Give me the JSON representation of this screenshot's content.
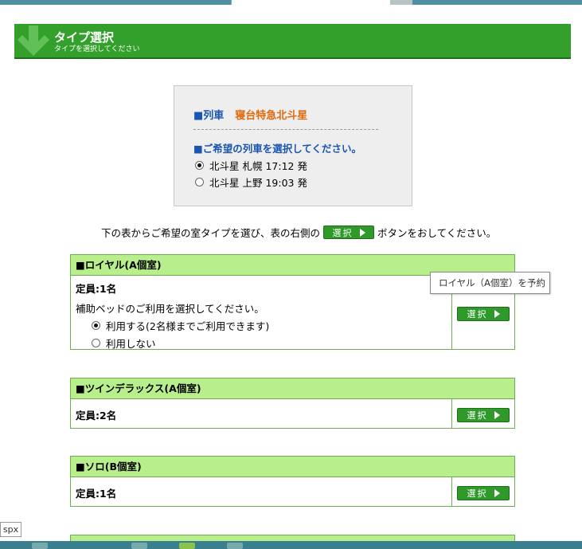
{
  "header": {
    "title": "タイプ選択",
    "subtitle": "タイプを選択してください",
    "color": "#33a02c"
  },
  "train": {
    "label": "■列車",
    "name": "寝台特急北斗星",
    "prompt": "■ご希望の列車を選択してください。",
    "options": [
      {
        "label": "北斗星 札幌 17:12 発",
        "selected": true
      },
      {
        "label": "北斗星 上野 19:03 発",
        "selected": false
      }
    ]
  },
  "instruction": {
    "before": "下の表からご希望の室タイプを選び、表の右側の",
    "button": "選択",
    "after": "ボタンをおしてください。"
  },
  "rooms": [
    {
      "title": "■ロイヤル(A個室)",
      "capacity": "定員:1名",
      "extra_prompt": "補助ベッドのご利用を選択してください。",
      "extra_options": [
        {
          "label": "利用する(2名様までご利用できます)",
          "selected": true
        },
        {
          "label": "利用しない",
          "selected": false
        }
      ],
      "select_label": "選択"
    },
    {
      "title": "■ツインデラックス(A個室)",
      "capacity": "定員:2名",
      "select_label": "選択"
    },
    {
      "title": "■ソロ(B個室)",
      "capacity": "定員:1名",
      "select_label": "選択"
    }
  ],
  "tooltip": "ロイヤル（A個室）を予約",
  "status_text": "spx"
}
